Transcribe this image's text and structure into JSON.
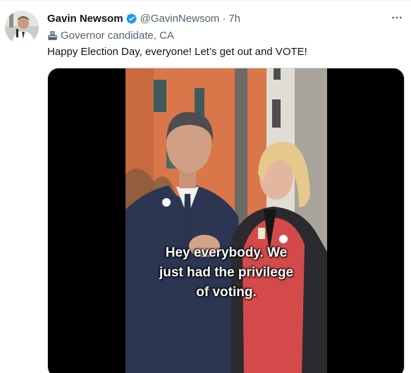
{
  "tweet": {
    "author_name": "Gavin Newsom",
    "handle": "@GavinNewsom",
    "separator": "·",
    "timestamp": "7h",
    "label": "Governor candidate, CA",
    "text": "Happy Election Day, everyone! Let’s get out and VOTE!",
    "more_icon": "more-horizontal-icon",
    "verified_icon": "verified-badge-icon",
    "label_icon": "ballot-box-icon"
  },
  "video": {
    "caption_lines": [
      "Hey everybody. We",
      "just had the privilege",
      "of voting."
    ]
  },
  "colors": {
    "text_primary": "#0f1419",
    "text_secondary": "#536471",
    "verified_blue": "#1d9bf0",
    "media_background": "#000000"
  }
}
